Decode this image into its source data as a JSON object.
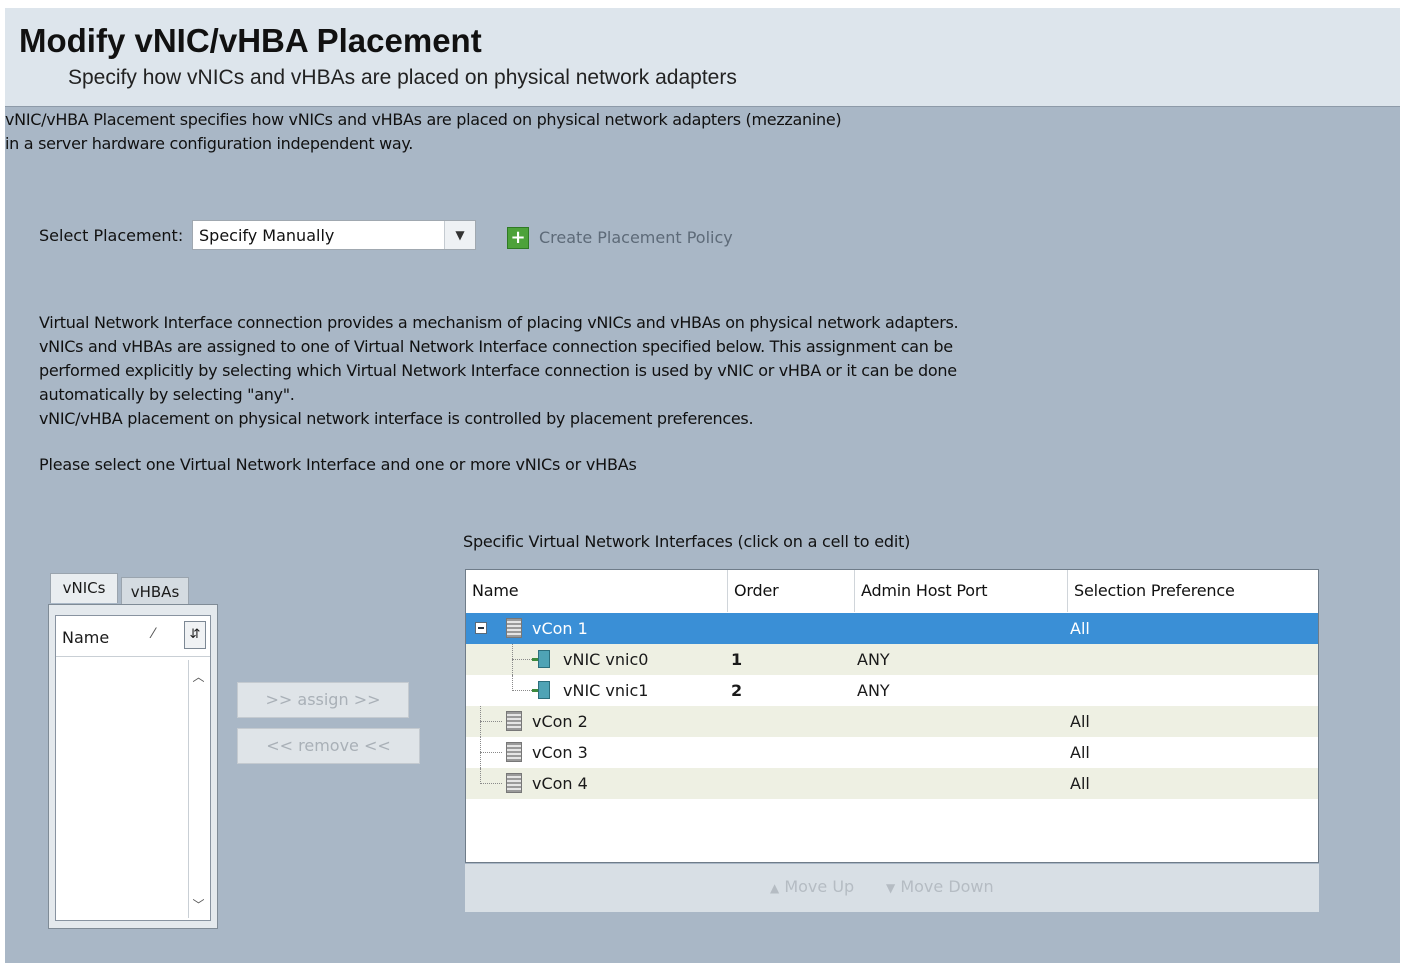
{
  "header": {
    "title": "Modify vNIC/vHBA Placement",
    "subtitle": "Specify how vNICs and vHBAs are placed on physical network adapters"
  },
  "intro": {
    "line1": "vNIC/vHBA Placement specifies how vNICs and vHBAs are placed on physical network adapters (mezzanine)",
    "line2": "in a server hardware configuration independent way."
  },
  "placement": {
    "label": "Select Placement:",
    "selected": "Specify Manually",
    "create_link": "Create Placement Policy"
  },
  "description": {
    "lines": [
      "Virtual Network Interface connection provides a mechanism of placing vNICs and vHBAs on physical network adapters.",
      "vNICs and vHBAs are assigned to one of Virtual Network Interface connection specified below. This assignment can be",
      "performed explicitly by selecting which Virtual Network Interface connection is used by vNIC or vHBA or it can be done",
      "automatically by selecting \"any\".",
      "vNIC/vHBA placement on physical network interface is controlled by placement preferences."
    ],
    "instruction": "Please select one Virtual Network Interface and one or more vNICs or vHBAs"
  },
  "left_panel": {
    "tabs": [
      "vNICs",
      "vHBAs"
    ],
    "active_tab": "vNICs",
    "column_name": "Name"
  },
  "buttons": {
    "assign": ">> assign >>",
    "remove": "<< remove <<"
  },
  "table": {
    "caption": "Specific Virtual Network Interfaces (click on a cell to edit)",
    "columns": [
      "Name",
      "Order",
      "Admin Host Port",
      "Selection Preference"
    ],
    "rows": [
      {
        "name": "vCon 1",
        "order": "",
        "port": "",
        "pref": "All",
        "type": "vcon",
        "selected": true
      },
      {
        "name": "vNIC vnic0",
        "order": "1",
        "port": "ANY",
        "pref": "",
        "type": "vnic"
      },
      {
        "name": "vNIC vnic1",
        "order": "2",
        "port": "ANY",
        "pref": "",
        "type": "vnic"
      },
      {
        "name": "vCon 2",
        "order": "",
        "port": "",
        "pref": "All",
        "type": "vcon"
      },
      {
        "name": "vCon 3",
        "order": "",
        "port": "",
        "pref": "All",
        "type": "vcon"
      },
      {
        "name": "vCon 4",
        "order": "",
        "port": "",
        "pref": "All",
        "type": "vcon"
      }
    ],
    "move_up": "Move Up",
    "move_down": "Move Down"
  },
  "colors": {
    "background": "#a9b7c6",
    "header": "#dde5ec",
    "selection": "#3a8fd6",
    "alt_row": "#eef0e3"
  }
}
